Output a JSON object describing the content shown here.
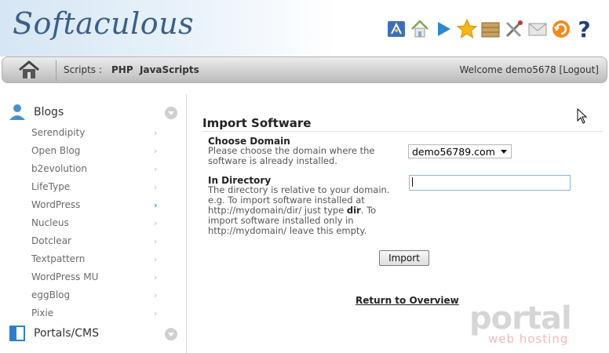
{
  "header": {
    "logo_text": "Softaculous",
    "toolbar_icons": [
      "demo-icon",
      "home-icon",
      "play-icon",
      "star-icon",
      "box-icon",
      "tools-icon",
      "mail-icon",
      "refresh-icon",
      "help-icon"
    ],
    "help_glyph": "?"
  },
  "nav": {
    "scripts_label": "Scripts :",
    "php": "PHP",
    "javascripts": "JavaScripts",
    "welcome": "Welcome demo5678 [Logout]"
  },
  "sidebar": {
    "categories": [
      {
        "label": "Blogs",
        "icon": "user-icon"
      },
      {
        "label": "Portals/CMS",
        "icon": "portal-icon"
      }
    ],
    "items": [
      {
        "label": "Serendipity",
        "active": false
      },
      {
        "label": "Open Blog",
        "active": false
      },
      {
        "label": "b2evolution",
        "active": false
      },
      {
        "label": "LifeType",
        "active": false
      },
      {
        "label": "WordPress",
        "active": true
      },
      {
        "label": "Nucleus",
        "active": false
      },
      {
        "label": "Dotclear",
        "active": false
      },
      {
        "label": "Textpattern",
        "active": false
      },
      {
        "label": "WordPress MU",
        "active": false
      },
      {
        "label": "eggBlog",
        "active": false
      },
      {
        "label": "Pixie",
        "active": false
      }
    ],
    "arrow_glyph": "›"
  },
  "main": {
    "title": "Import Software",
    "domain": {
      "label": "Choose Domain",
      "help": "Please choose the domain where the software is already installed.",
      "selected": "demo56789.com"
    },
    "directory": {
      "label": "In Directory",
      "help_1": "The directory is relative to your domain. e.g. To import software installed at http://mydomain/dir/ just type ",
      "help_bold": "dir",
      "help_2": ". To import software installed only in http://mydomain/ leave this empty.",
      "value": ""
    },
    "import_button": "Import",
    "return_link": "Return to Overview"
  },
  "watermark": {
    "main": "portal",
    "sub": "web hosting"
  },
  "colors": {
    "accent": "#2a8be0",
    "nav_bar": "#d3d3d3",
    "logo": "#3b5f86"
  }
}
